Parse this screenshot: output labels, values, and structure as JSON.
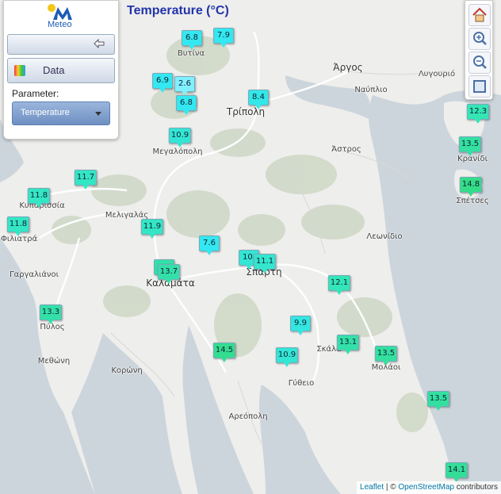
{
  "title": "Temperature (°C)",
  "logo": {
    "text": "Meteo"
  },
  "panel": {
    "data_label": "Data",
    "parameter_label": "Parameter:",
    "parameter_value": "Temperature"
  },
  "attribution": {
    "leaflet": "Leaflet",
    "separator": " | © ",
    "osm": "OpenStreetMap",
    "contributors": " contributors"
  },
  "places": [
    {
      "name": "Βυτίνα"
    },
    {
      "name": "Άργος"
    },
    {
      "name": "Ναύπλιο"
    },
    {
      "name": "Λυγουριό"
    },
    {
      "name": "Τρίπολη"
    },
    {
      "name": "Μεγαλόπολη"
    },
    {
      "name": "Άστρος"
    },
    {
      "name": "Κρανίδι"
    },
    {
      "name": "Κυπαρισσία"
    },
    {
      "name": "Σπέτσες"
    },
    {
      "name": "Μελιγαλάς"
    },
    {
      "name": "Φιλιατρά"
    },
    {
      "name": "Λεωνίδιο"
    },
    {
      "name": "Γαργαλιάνοι"
    },
    {
      "name": "Καλαμάτα"
    },
    {
      "name": "Σπάρτη"
    },
    {
      "name": "Πύλος"
    },
    {
      "name": "Σκάλα"
    },
    {
      "name": "Μεθώνη"
    },
    {
      "name": "Κορώνη"
    },
    {
      "name": "Μολάοι"
    },
    {
      "name": "Γύθειο"
    },
    {
      "name": "Αρεόπολη"
    }
  ],
  "stations": [
    {
      "value": "6.8",
      "color": "#33e8f0"
    },
    {
      "value": "7.9",
      "color": "#33e8f0"
    },
    {
      "value": "6.9",
      "color": "#33e8f0"
    },
    {
      "value": "2.6",
      "color": "#80f0ff"
    },
    {
      "value": "6.8",
      "color": "#33e8f0"
    },
    {
      "value": "8.4",
      "color": "#33e8e8"
    },
    {
      "value": "10.9",
      "color": "#33e6d4"
    },
    {
      "value": "12.3",
      "color": "#33e6b4"
    },
    {
      "value": "13.5",
      "color": "#33e0a0"
    },
    {
      "value": "11.7",
      "color": "#33e6c4"
    },
    {
      "value": "14.8",
      "color": "#33dd88"
    },
    {
      "value": "11.8",
      "color": "#33e6c4"
    },
    {
      "value": "11.8",
      "color": "#33e6c4"
    },
    {
      "value": "11.9",
      "color": "#33e6c4"
    },
    {
      "value": "7.6",
      "color": "#33e8f0"
    },
    {
      "value": "10.",
      "color": "#33e6d4"
    },
    {
      "value": "11.1",
      "color": "#33e6cc"
    },
    {
      "value": "",
      "color": "#33e0a8"
    },
    {
      "value": "13.7",
      "color": "#33e0a8"
    },
    {
      "value": "12.1",
      "color": "#33e6b8"
    },
    {
      "value": "13.3",
      "color": "#33e0a8"
    },
    {
      "value": "9.9",
      "color": "#33e6e0"
    },
    {
      "value": "13.1",
      "color": "#33e0a8"
    },
    {
      "value": "14.5",
      "color": "#33dd90"
    },
    {
      "value": "10.9",
      "color": "#33e6d4"
    },
    {
      "value": "13.5",
      "color": "#33e0a0"
    },
    {
      "value": "13.5",
      "color": "#33e0a0"
    },
    {
      "value": "14.1",
      "color": "#33dd98"
    }
  ],
  "colors": {
    "land": "#eeeeec",
    "sea": "#cdd5dc",
    "forest": "#c9d7c1",
    "road": "#ffffff",
    "title": "#2233aa"
  },
  "icons": [
    "home-icon",
    "zoom-in-icon",
    "zoom-out-icon",
    "fullscreen-icon",
    "collapse-arrow-icon",
    "data-palette-icon"
  ]
}
